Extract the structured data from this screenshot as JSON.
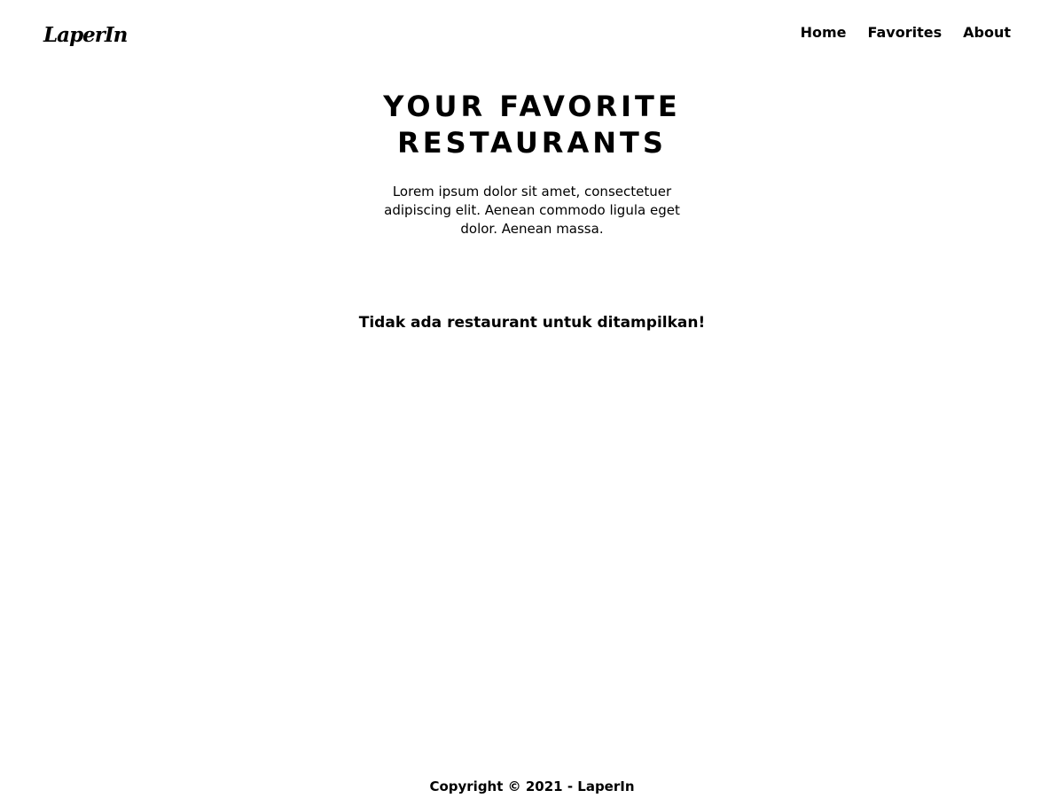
{
  "header": {
    "logo": "LaperIn",
    "nav": {
      "home": "Home",
      "favorites": "Favorites",
      "about": "About"
    }
  },
  "hero": {
    "title": "YOUR FAVORITE RESTAURANTS",
    "description": "Lorem ipsum dolor sit amet, consectetuer adipiscing elit. Aenean commodo ligula eget dolor. Aenean massa."
  },
  "main": {
    "empty_message": "Tidak ada restaurant untuk ditampilkan!"
  },
  "footer": {
    "copyright": "Copyright © 2021 - LaperIn"
  }
}
